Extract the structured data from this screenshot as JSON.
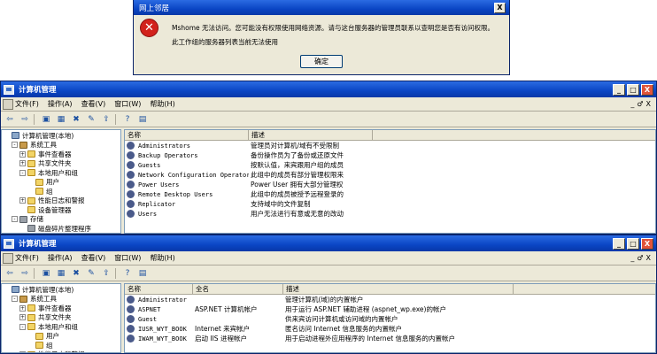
{
  "dialog": {
    "title": "网上邻居",
    "message_line1": "Mshome 无法访问。您可能没有权限使用网络资源。请与这台服务器的管理员联系以查明您是否有访问权限。",
    "message_line2": "此工作组的服务器列表当前无法使用",
    "ok_label": "确定",
    "close_glyph": "X",
    "icon": "error-icon"
  },
  "window1": {
    "title": "计算机管理",
    "controls": {
      "minimize": "_",
      "maximize": "□",
      "close": "X"
    },
    "menu": [
      "文件(F)",
      "操作(A)",
      "查看(V)",
      "窗口(W)",
      "帮助(H)"
    ],
    "menu_controls": [
      "_",
      "♂",
      "X"
    ],
    "tree": [
      {
        "label": "计算机管理(本地)",
        "level": 0,
        "expander": "",
        "icon": "computer-icon"
      },
      {
        "label": "系统工具",
        "level": 1,
        "expander": "-",
        "icon": "tools-icon"
      },
      {
        "label": "事件查看器",
        "level": 2,
        "expander": "+",
        "icon": "folder-icon"
      },
      {
        "label": "共享文件夹",
        "level": 2,
        "expander": "+",
        "icon": "folder-icon"
      },
      {
        "label": "本地用户和组",
        "level": 2,
        "expander": "-",
        "icon": "folder-icon"
      },
      {
        "label": "用户",
        "level": 3,
        "expander": "",
        "icon": "folder-icon"
      },
      {
        "label": "组",
        "level": 3,
        "expander": "",
        "icon": "folder-icon"
      },
      {
        "label": "性能日志和警报",
        "level": 2,
        "expander": "+",
        "icon": "folder-icon"
      },
      {
        "label": "设备管理器",
        "level": 2,
        "expander": "",
        "icon": "folder-icon"
      },
      {
        "label": "存储",
        "level": 1,
        "expander": "-",
        "icon": "disk-icon"
      },
      {
        "label": "磁盘碎片整理程序",
        "level": 2,
        "expander": "",
        "icon": "disk-icon"
      }
    ],
    "columns": [
      "名称",
      "描述"
    ],
    "rows": [
      {
        "name": "Administrators",
        "desc": "管理员对计算机/域有不受限制"
      },
      {
        "name": "Backup Operators",
        "desc": "备份操作员为了备份或还原文件"
      },
      {
        "name": "Guests",
        "desc": "按默认值，来宾跟用户组的成员"
      },
      {
        "name": "Network Configuration Operators",
        "desc": "此组中的成员有部分管理权限来"
      },
      {
        "name": "Power Users",
        "desc": "Power User 拥有大部分管理权"
      },
      {
        "name": "Remote Desktop Users",
        "desc": "此组中的成员被授予远程登录的"
      },
      {
        "name": "Replicator",
        "desc": "支持域中的文件复制"
      },
      {
        "name": "Users",
        "desc": "用户无法进行有意或无意的改动"
      }
    ]
  },
  "window2": {
    "title": "计算机管理",
    "controls": {
      "minimize": "_",
      "maximize": "□",
      "close": "X"
    },
    "menu": [
      "文件(F)",
      "操作(A)",
      "查看(V)",
      "窗口(W)",
      "帮助(H)"
    ],
    "menu_controls": [
      "_",
      "♂",
      "X"
    ],
    "tree": [
      {
        "label": "计算机管理(本地)",
        "level": 0,
        "expander": "",
        "icon": "computer-icon"
      },
      {
        "label": "系统工具",
        "level": 1,
        "expander": "-",
        "icon": "tools-icon"
      },
      {
        "label": "事件查看器",
        "level": 2,
        "expander": "+",
        "icon": "folder-icon"
      },
      {
        "label": "共享文件夹",
        "level": 2,
        "expander": "+",
        "icon": "folder-icon"
      },
      {
        "label": "本地用户和组",
        "level": 2,
        "expander": "-",
        "icon": "folder-icon"
      },
      {
        "label": "用户",
        "level": 3,
        "expander": "",
        "icon": "folder-icon"
      },
      {
        "label": "组",
        "level": 3,
        "expander": "",
        "icon": "folder-icon"
      },
      {
        "label": "性能日志和警报",
        "level": 2,
        "expander": "+",
        "icon": "folder-icon"
      }
    ],
    "columns": [
      "名称",
      "全名",
      "描述"
    ],
    "rows": [
      {
        "name": "Administrator",
        "full": "",
        "desc": "管理计算机(域)的内置帐户"
      },
      {
        "name": "ASPNET",
        "full": "ASP.NET 计算机帐户",
        "desc": "用于运行 ASP.NET 辅助进程 (aspnet_wp.exe)的帐户"
      },
      {
        "name": "Guest",
        "full": "",
        "desc": "供来宾访问计算机或访问域的内置帐户"
      },
      {
        "name": "IUSR_WYT_BOOK",
        "full": "Internet 来宾帐户",
        "desc": "匿名访问 Internet 信息服务的内置帐户"
      },
      {
        "name": "IWAM_WYT_BOOK",
        "full": "启动 IIS 进程帐户",
        "desc": "用于启动进程外应用程序的 Internet 信息服务的内置帐户"
      }
    ]
  },
  "toolbar_icons": [
    "back-icon",
    "forward-icon",
    "up-folder-icon",
    "tree-toggle-icon",
    "properties-icon",
    "refresh-icon",
    "export-icon",
    "help-icon",
    "console-icon"
  ],
  "toolbar_glyphs": [
    "⇦",
    "⇨",
    "▣",
    "▦",
    "✖",
    "✎",
    "⇪",
    "?",
    "▤"
  ]
}
